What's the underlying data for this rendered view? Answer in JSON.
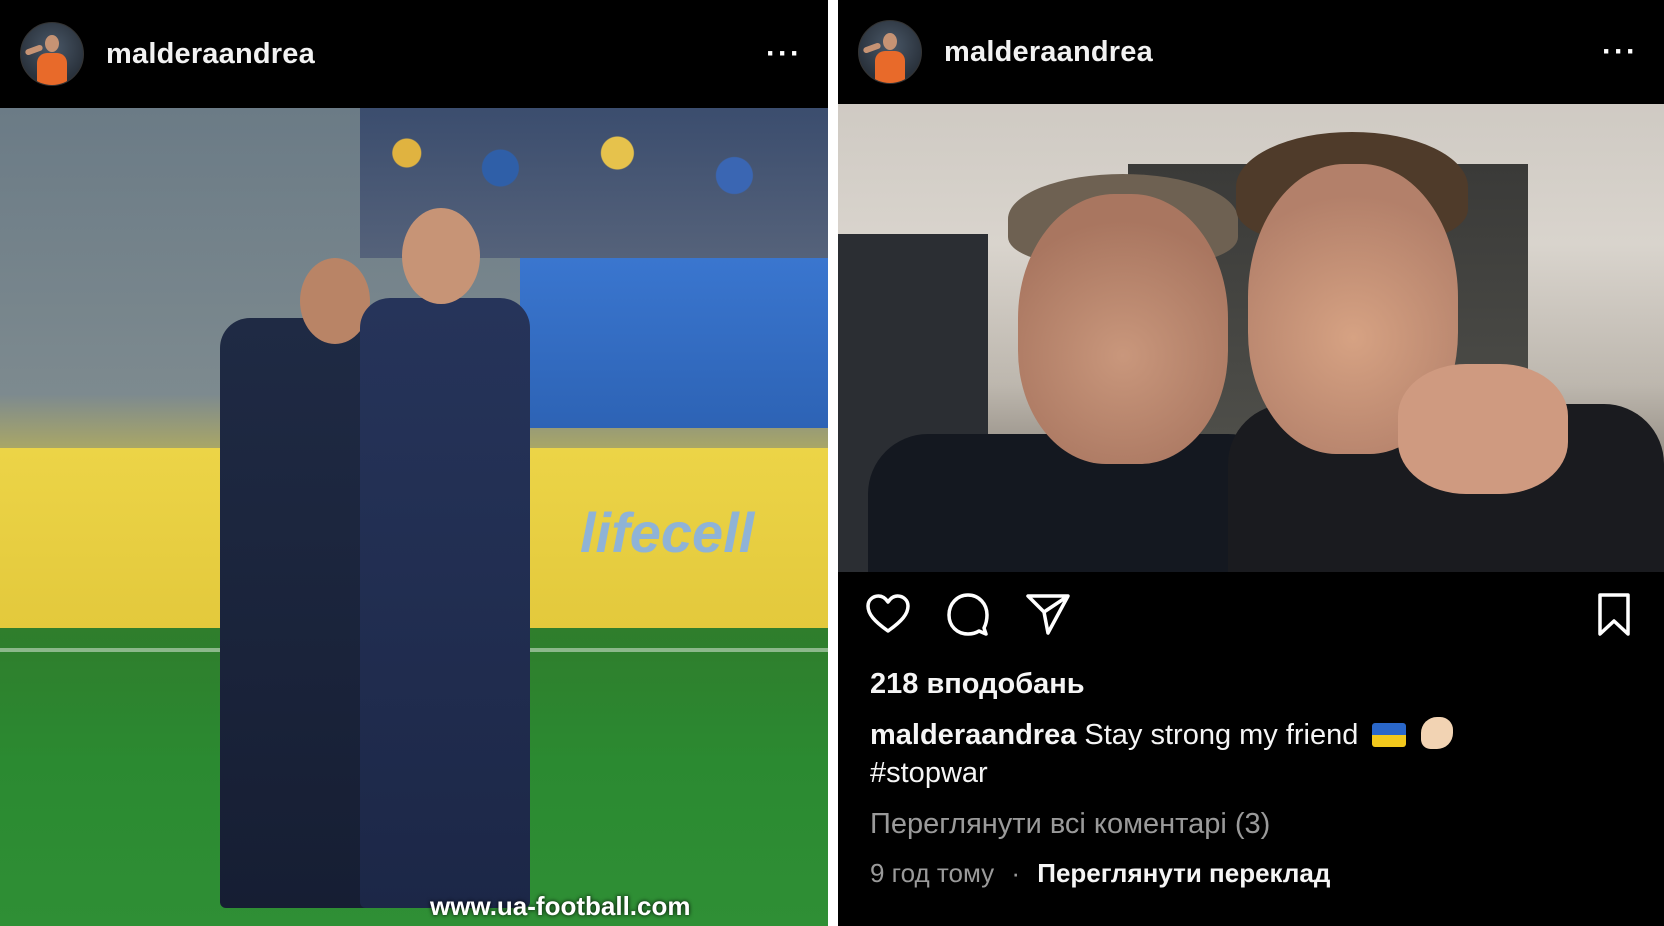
{
  "left_post": {
    "username": "malderaandrea",
    "more_label": "···",
    "sponsor": "lifecell",
    "watermark": "www.ua-football.com"
  },
  "right_post": {
    "username": "malderaandrea",
    "more_label": "···",
    "icons": [
      "heart-icon",
      "comment-icon",
      "share-icon",
      "bookmark-icon"
    ],
    "likes": "218 вподобань",
    "caption_user": "malderaandrea",
    "caption_text": "Stay strong my friend",
    "caption_tag": "#stopwar",
    "view_comments": "Переглянути всі коментарі (3)",
    "time_ago": "9 год тому",
    "dot": "·",
    "translate": "Переглянути переклад"
  },
  "colors": {
    "background": "#000000",
    "text": "#f5f5f5",
    "muted": "#9a9a9a"
  }
}
